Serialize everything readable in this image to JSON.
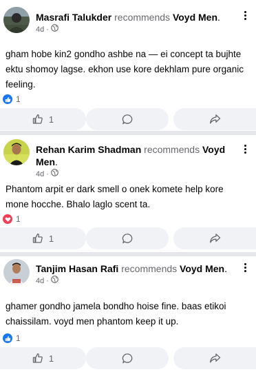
{
  "posts": [
    {
      "author": "Masrafi Talukder",
      "verb": "recommends",
      "page_name": "Voyd Men",
      "page_suffix": ".",
      "time": "4d",
      "privacy_icon": "globe-icon",
      "text": "gham hobe kin2 gondho ashbe na — ei concept ta bujhte ektu shomoy lagse. ekhon use kore dekhlam pure organic feeling.",
      "reaction_icon": "like-reaction-icon",
      "reaction_color": "#1877f2",
      "reaction_count": "1",
      "like_count": "1"
    },
    {
      "author": "Rehan Karim Shadman",
      "verb": "recommends",
      "page_name": "Voyd Men",
      "page_suffix": ".",
      "time": "4d",
      "privacy_icon": "globe-icon",
      "text": "Phantom arpit er dark smell o onek komete help kore mone hocche. Bhalo laglo scent ta.",
      "reaction_icon": "love-reaction-icon",
      "reaction_color": "#f33e58",
      "reaction_count": "1",
      "like_count": "1"
    },
    {
      "author": "Tanjim Hasan Rafi",
      "verb": "recommends",
      "page_name": "Voyd Men",
      "page_suffix": ".",
      "time": "4d",
      "privacy_icon": "globe-icon",
      "text": "ghamer gondho jamela bondho hoise fine. baas etikoi chaissilam. voyd men phantom keep it up.",
      "reaction_icon": "like-reaction-icon",
      "reaction_color": "#1877f2",
      "reaction_count": "1",
      "like_count": "1"
    }
  ],
  "colors": {
    "background": "#e4e6ea",
    "card": "#ffffff",
    "button": "#f0f2f5",
    "secondary_text": "#65676b"
  }
}
